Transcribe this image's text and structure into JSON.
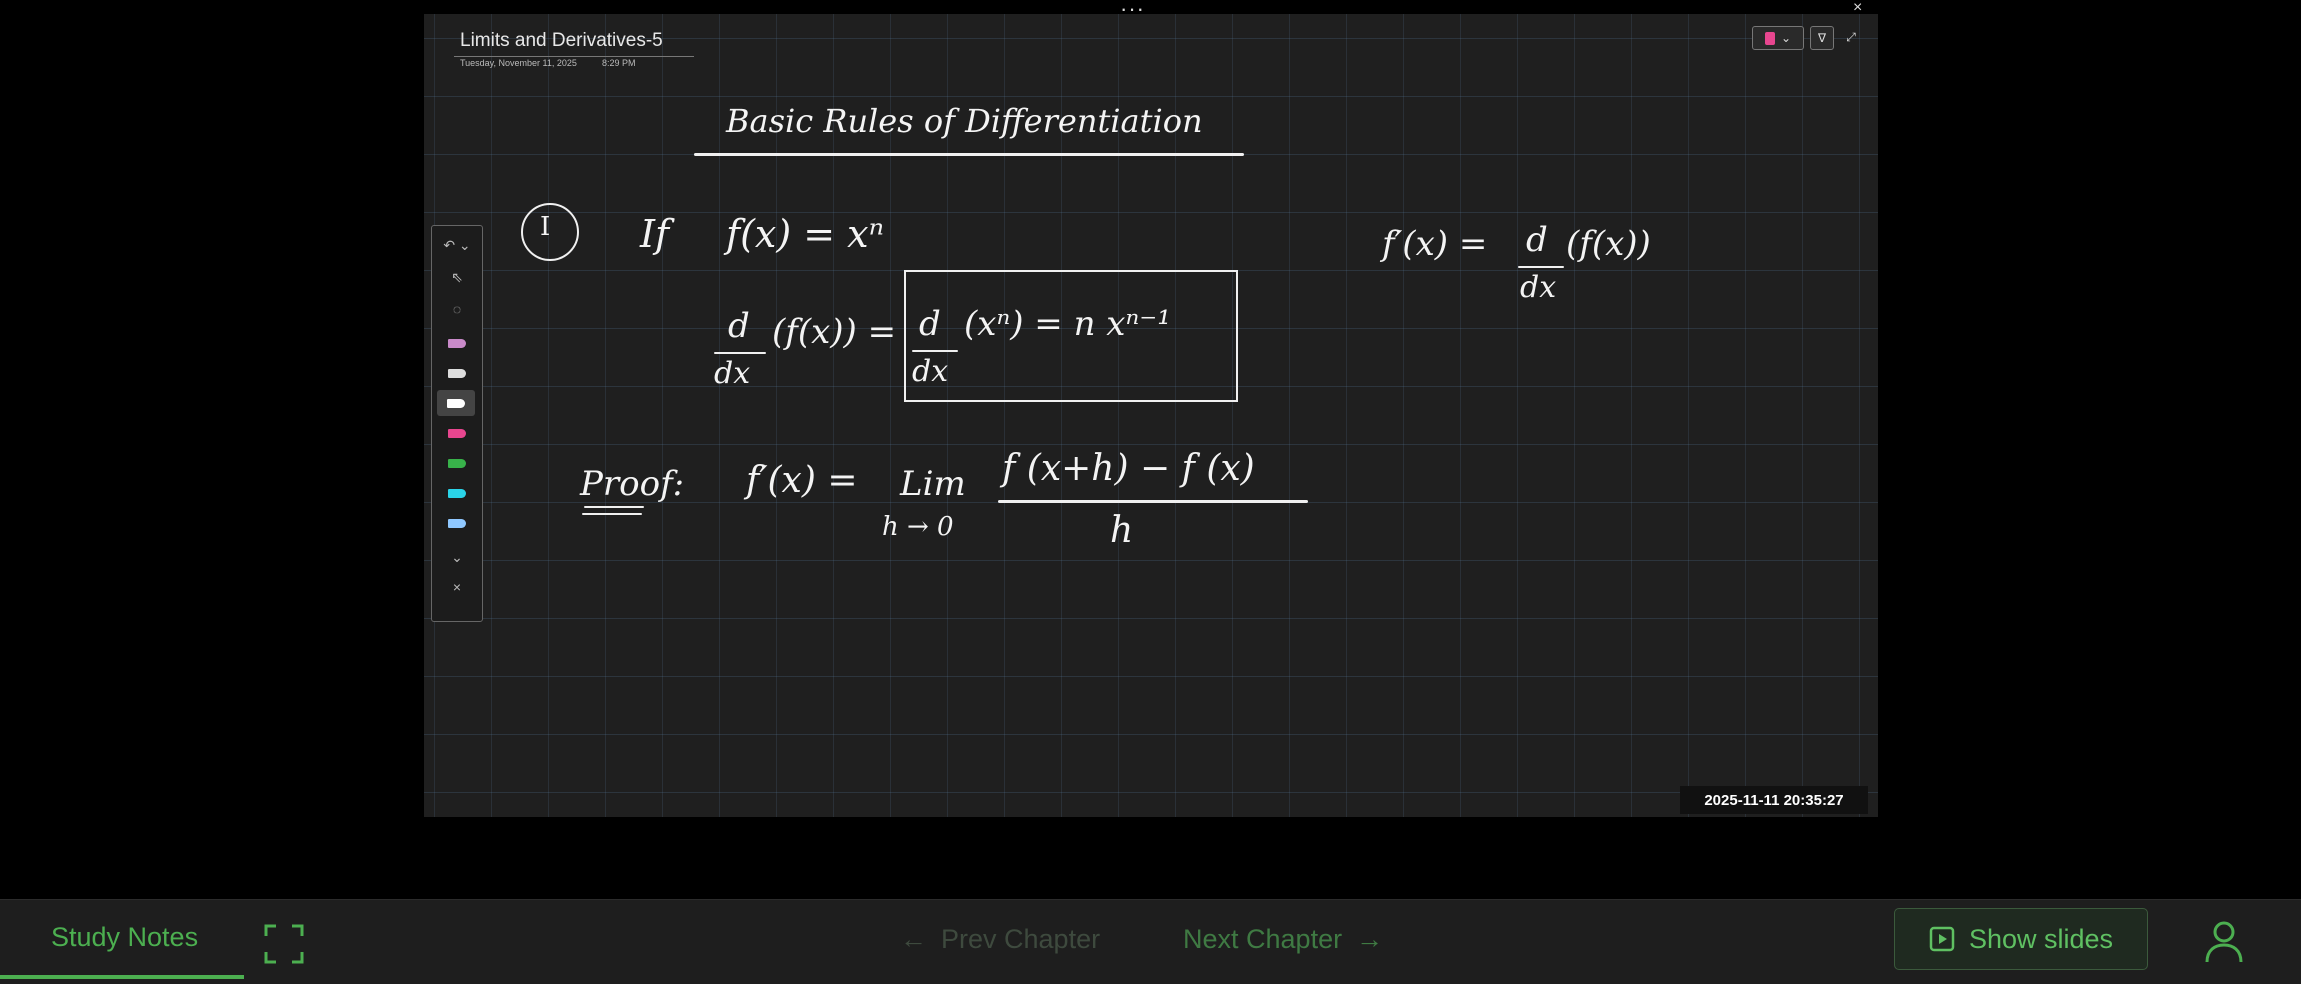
{
  "window": {
    "top_dots": "···",
    "close_glyph": "×"
  },
  "page": {
    "title": "Limits and Derivatives-5",
    "date": "Tuesday, November 11, 2025",
    "time": "8:29 PM"
  },
  "whiteboard": {
    "heading": "Basic Rules of Differentiation",
    "rule_number": "I",
    "if_text": "If",
    "fx_eq_xn": "f(x) = xⁿ",
    "ddx": "d",
    "dx": "dx",
    "of_fx_eq": "(f(x)) =",
    "boxed_rhs": "(xⁿ) = n xⁿ⁻¹",
    "side_lhs": "f′(x) =",
    "side_rhs": "(f(x))",
    "proof_label": "Proof:",
    "proof_lhs": "f′(x) =",
    "lim": "Lim",
    "lim_sub": "h → 0",
    "numerator": "f (x+h) − f (x)",
    "denominator": "h"
  },
  "timestamp": "2025-11-11  20:35:27",
  "bottom_bar": {
    "study_notes": "Study Notes",
    "prev_chapter": "Prev Chapter",
    "next_chapter": "Next Chapter",
    "show_slides": "Show slides",
    "prev_arrow": "←",
    "next_arrow": "→"
  },
  "colors": {
    "accent": "#4caf50",
    "pen_pink": "#e8468f",
    "pen_green": "#38b24a",
    "pen_cyan": "#2ad4e8",
    "pen_blue": "#8fc8ff"
  },
  "palette_tools": [
    "undo-icon",
    "select-icon",
    "lasso-icon",
    "highlighter-pink-icon",
    "eraser-icon",
    "pen-white-icon",
    "pen-pink-icon",
    "pen-green-icon",
    "pen-cyan-icon",
    "pen-blue-icon",
    "chevron-down-icon",
    "close-icon"
  ]
}
